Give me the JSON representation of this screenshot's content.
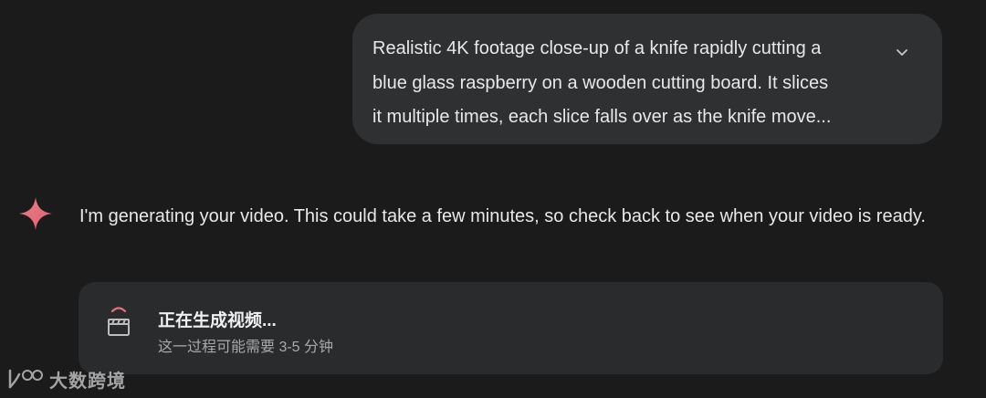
{
  "user_message": {
    "text": "Realistic 4K footage close-up of a knife rapidly cutting a\nblue glass raspberry on a wooden cutting board. It slices\nit multiple times, each slice falls over as the knife move...",
    "expand_icon": "chevron-down-icon"
  },
  "assistant": {
    "icon": "sparkle-icon",
    "accent_color": "#e8707a",
    "message": "I'm generating your video. This could take a few minutes, so check back to see when your video is ready."
  },
  "status_card": {
    "icon": "clapperboard-icon",
    "title": "正在生成视频...",
    "subtitle": "这一过程可能需要 3-5 分钟"
  },
  "watermark": {
    "logo_text": "100",
    "text": "大数跨境"
  }
}
